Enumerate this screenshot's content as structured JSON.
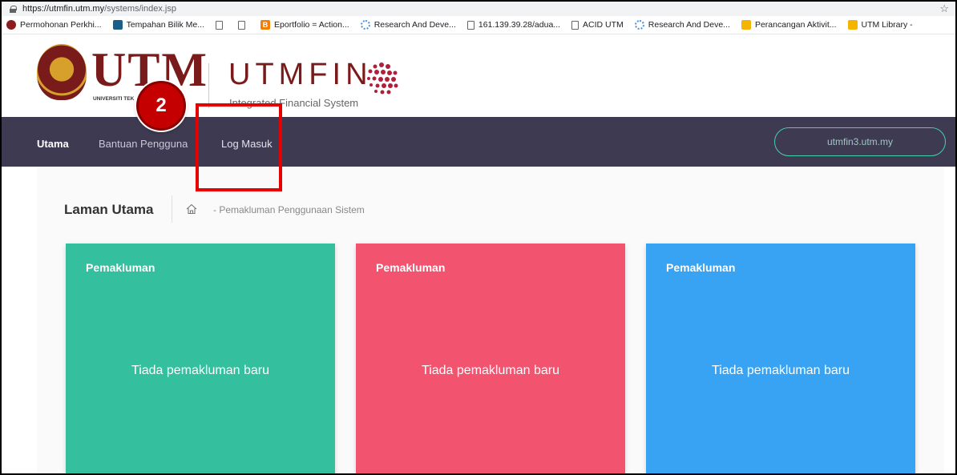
{
  "browser": {
    "url_host": "https://utmfin.utm.my",
    "url_path": "/systems/index.jsp",
    "bookmarks": [
      {
        "label": "Permohonan Perkhi...",
        "icon": "utm-crest-icon"
      },
      {
        "label": "Tempahan Bilik Me...",
        "icon": "trello-icon"
      },
      {
        "label": "",
        "icon": "page-icon"
      },
      {
        "label": "",
        "icon": "page-icon"
      },
      {
        "label": "Eportfolio = Action...",
        "icon": "blogger-icon"
      },
      {
        "label": "Research And Deve...",
        "icon": "spinner-icon"
      },
      {
        "label": "161.139.39.28/adua...",
        "icon": "page-icon"
      },
      {
        "label": "ACID UTM",
        "icon": "page-icon"
      },
      {
        "label": "Research And Deve...",
        "icon": "spinner-icon"
      },
      {
        "label": "Perancangan Aktivit...",
        "icon": "yellow-square-icon"
      },
      {
        "label": "UTM Library -",
        "icon": "yellow-square-icon"
      }
    ]
  },
  "header": {
    "utm_wordmark": "UTM",
    "utm_subtitle": "UNIVERSITI TEK",
    "app_name": "UTMFIN",
    "tagline": "Integrated Financial System"
  },
  "annotation": {
    "step_number": "2",
    "highlight_color": "#e60000"
  },
  "nav": {
    "items": [
      {
        "label": "Utama",
        "active": true
      },
      {
        "label": "Bantuan Pengguna",
        "active": false
      },
      {
        "label": "Log Masuk",
        "active": false
      }
    ],
    "server_button": "utmfin3.utm.my"
  },
  "page": {
    "title": "Laman Utama",
    "breadcrumb": "- Pemakluman Penggunaan Sistem"
  },
  "cards": [
    {
      "title": "Pemakluman",
      "body": "Tiada pemakluman baru",
      "color": "#34bf9e"
    },
    {
      "title": "Pemakluman",
      "body": "Tiada pemakluman baru",
      "color": "#f2546f"
    },
    {
      "title": "Pemakluman",
      "body": "Tiada pemakluman baru",
      "color": "#38a3f3"
    }
  ],
  "colors": {
    "navbar": "#3d3a52",
    "brand": "#7a1b1b",
    "pill_border": "#45d0a8"
  }
}
